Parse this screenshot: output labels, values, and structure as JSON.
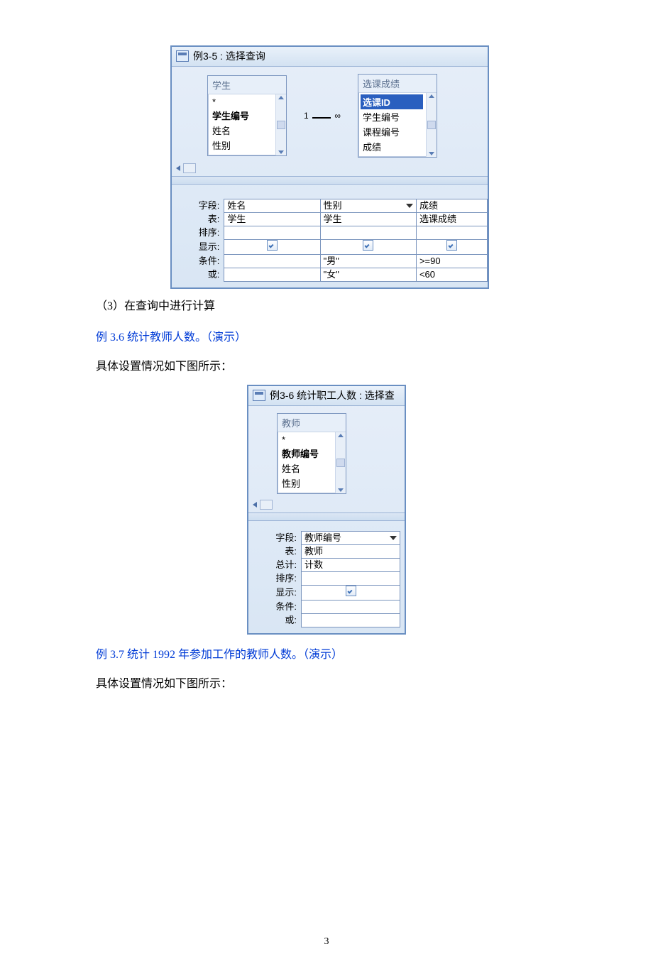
{
  "fig1": {
    "title": "例3-5 : 选择查询",
    "table_student": {
      "title": "学生",
      "fields": [
        "*",
        "学生编号",
        "姓名",
        "性别"
      ]
    },
    "relation": {
      "left": "1",
      "right": "∞"
    },
    "table_course": {
      "title": "选课成绩",
      "fields": [
        "选课ID",
        "学生编号",
        "课程编号",
        "成绩"
      ]
    },
    "grid": {
      "rows": {
        "field": "字段:",
        "table": "表:",
        "sort": "排序:",
        "show": "显示:",
        "criteria": "条件:",
        "or": "或:"
      },
      "cols": [
        {
          "field": "姓名",
          "table": "学生",
          "show": true,
          "criteria": "",
          "or": ""
        },
        {
          "field": "性别",
          "table": "学生",
          "show": true,
          "criteria": "\"男\"",
          "or": "\"女\"",
          "dropdown": true
        },
        {
          "field": "成绩",
          "table": "选课成绩",
          "show": true,
          "criteria": ">=90",
          "or": "<60"
        }
      ]
    }
  },
  "text": {
    "p3": "（3）在查询中进行计算",
    "ex36": "例 3.6  统计教师人数。（演示）",
    "p36_desc": "具体设置情况如下图所示：",
    "ex37": "例 3.7  统计 1992 年参加工作的教师人数。（演示）",
    "p37_desc": "具体设置情况如下图所示："
  },
  "fig2": {
    "title": "例3-6 统计职工人数 : 选择查",
    "table_teacher": {
      "title": "教师",
      "fields": [
        "*",
        "教师编号",
        "姓名",
        "性别"
      ]
    },
    "grid": {
      "rows": {
        "field": "字段:",
        "table": "表:",
        "total": "总计:",
        "sort": "排序:",
        "show": "显示:",
        "criteria": "条件:",
        "or": "或:"
      },
      "col": {
        "field": "教师编号",
        "table": "教师",
        "total": "计数",
        "show": true
      }
    }
  },
  "page_number": "3"
}
